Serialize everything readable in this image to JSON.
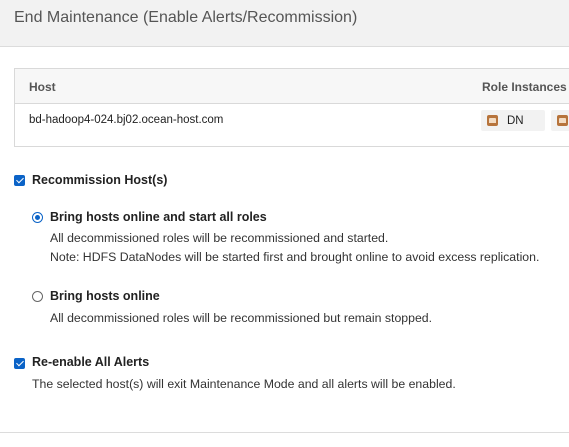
{
  "dialog": {
    "title": "End Maintenance (Enable Alerts/Recommission)"
  },
  "host_table": {
    "columns": [
      "Host",
      "Role Instances"
    ],
    "rows": [
      {
        "host": "bd-hadoop4-024.bj02.ocean-host.com",
        "roles": [
          {
            "icon": "hdfs-role-icon",
            "label": "DN"
          },
          {
            "icon": "hdfs-role-icon",
            "label": ""
          }
        ]
      }
    ]
  },
  "recommission": {
    "checked": true,
    "label": "Recommission Host(s)",
    "options": [
      {
        "selected": true,
        "label": "Bring hosts online and start all roles",
        "description": [
          "All decommissioned roles will be recommissioned and started.",
          "Note: HDFS DataNodes will be started first and brought online to avoid excess replication."
        ]
      },
      {
        "selected": false,
        "label": "Bring hosts online",
        "description": [
          "All decommissioned roles will be recommissioned but remain stopped."
        ]
      }
    ]
  },
  "alerts": {
    "checked": true,
    "label": "Re-enable All Alerts",
    "description": "The selected host(s) will exit Maintenance Mode and all alerts will be enabled."
  },
  "colors": {
    "accent": "#0b63c7",
    "header_bg": "#f2f2f2",
    "role_icon": "#b7743c"
  }
}
